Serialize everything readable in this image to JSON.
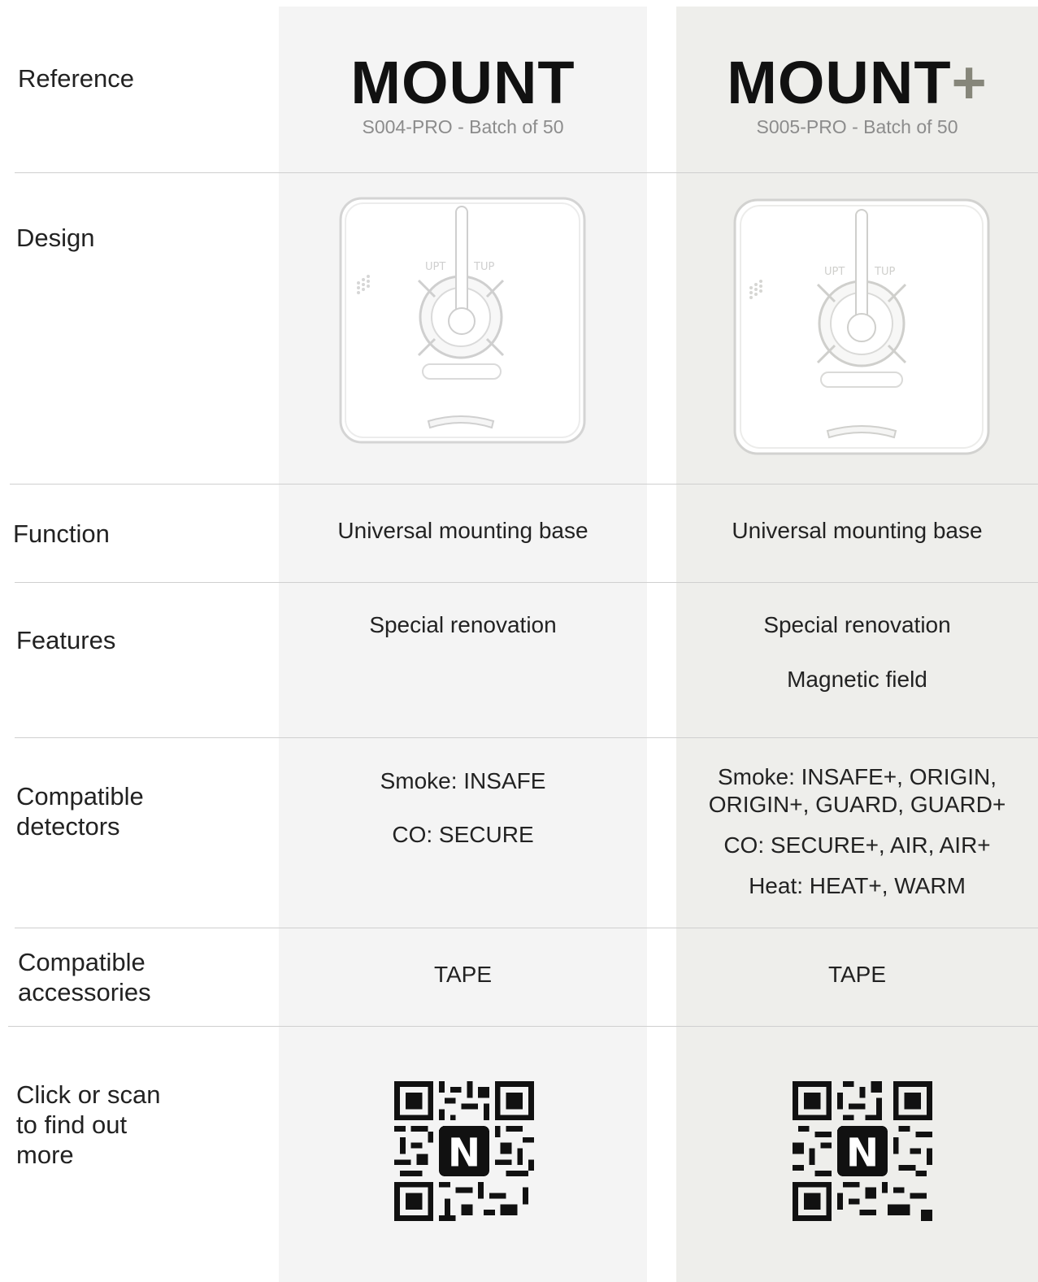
{
  "rows": {
    "reference": "Reference",
    "design": "Design",
    "function": "Function",
    "features": "Features",
    "detectors_1": "Compatible",
    "detectors_2": "detectors",
    "accessories_1": "Compatible",
    "accessories_2": "accessories",
    "more_1": "Click or scan",
    "more_2": "to find out",
    "more_3": "more"
  },
  "products": [
    {
      "name": "MOUNT",
      "name_suffix": "",
      "reference": "S004-PRO - Batch of 50",
      "function": "Universal mounting base",
      "features": [
        "Special renovation"
      ],
      "detectors": [
        "Smoke: INSAFE",
        "CO: SECURE"
      ],
      "accessories": "TAPE"
    },
    {
      "name": "MOUNT",
      "name_suffix": "+",
      "reference": "S005-PRO - Batch of 50",
      "function": "Universal mounting base",
      "features": [
        "Special renovation",
        "Magnetic field"
      ],
      "detectors": [
        "Smoke: INSAFE+, ORIGIN,",
        "ORIGIN+, GUARD, GUARD+",
        "CO: SECURE+, AIR, AIR+",
        "Heat: HEAT+, WARM"
      ],
      "accessories": "TAPE"
    }
  ],
  "design_labels": {
    "left": "UPT",
    "right": "TUP"
  },
  "qr_logo": "N",
  "colors": {
    "col1_bg": "#f4f4f4",
    "col2_bg": "#eeeeeb",
    "plus": "#86867a"
  }
}
